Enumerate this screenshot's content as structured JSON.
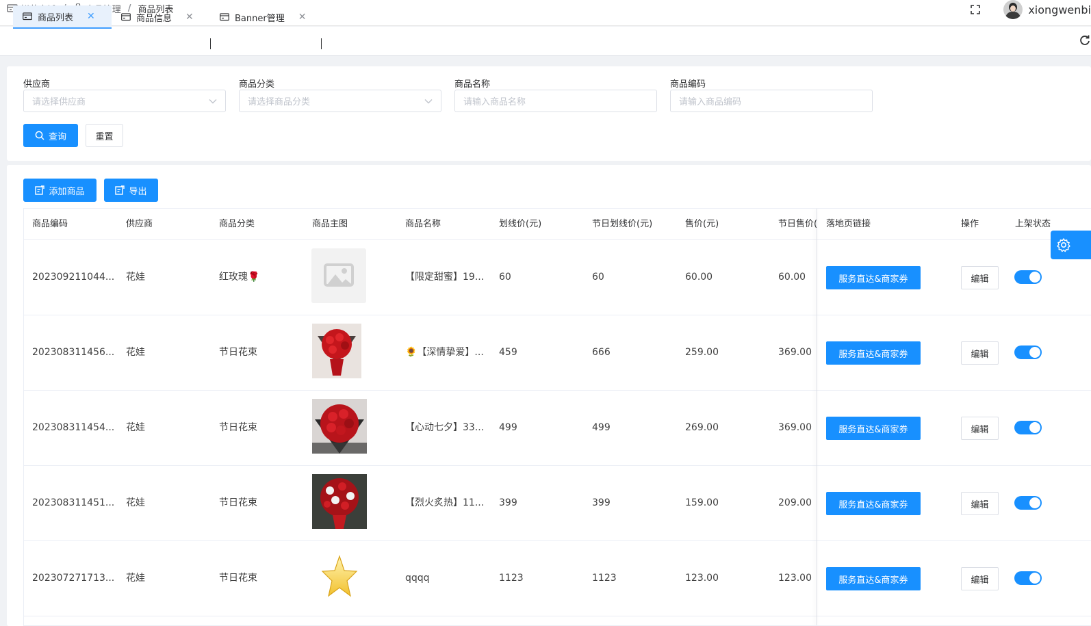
{
  "breadcrumb": [
    "鲜花商城",
    "商品管理",
    "商品列表"
  ],
  "user": {
    "name": "xiongwenbi"
  },
  "tabs": [
    {
      "label": "商品列表",
      "active": true
    },
    {
      "label": "商品信息",
      "active": false
    },
    {
      "label": "Banner管理",
      "active": false
    }
  ],
  "search": {
    "fields": [
      {
        "label": "供应商",
        "placeholder": "请选择供应商",
        "type": "select"
      },
      {
        "label": "商品分类",
        "placeholder": "请选择商品分类",
        "type": "select"
      },
      {
        "label": "商品名称",
        "placeholder": "请输入商品名称",
        "type": "input"
      },
      {
        "label": "商品编码",
        "placeholder": "请输入商品编码",
        "type": "input"
      }
    ],
    "query_label": "查询",
    "reset_label": "重置"
  },
  "toolbar": {
    "add_label": "添加商品",
    "export_label": "导出"
  },
  "table": {
    "headers": [
      "商品编码",
      "供应商",
      "商品分类",
      "商品主图",
      "商品名称",
      "划线价(元)",
      "节日划线价(元)",
      "售价(元)",
      "节日售价(元)",
      "落地页链接",
      "操作",
      "上架状态"
    ],
    "link_label": "服务直达&商家券",
    "edit_label": "编辑",
    "rows": [
      {
        "code": "202309211044...",
        "supplier": "花娃",
        "category": "红玫瑰🌹",
        "image": "placeholder-icon",
        "name": "【限定甜蜜】19...",
        "list_price": "60",
        "holiday_list_price": "60",
        "price": "60.00",
        "holiday_price": "60.00",
        "on_shelf": true
      },
      {
        "code": "202308311456...",
        "supplier": "花娃",
        "category": "节日花束",
        "image": "red-bouquet-photo",
        "name": "🌻【深情挚爱】...",
        "list_price": "459",
        "holiday_list_price": "666",
        "price": "259.00",
        "holiday_price": "369.00",
        "on_shelf": true
      },
      {
        "code": "202308311454...",
        "supplier": "花娃",
        "category": "节日花束",
        "image": "red-rose-bouquet-photo",
        "name": "【心动七夕】33...",
        "list_price": "499",
        "holiday_list_price": "499",
        "price": "269.00",
        "holiday_price": "369.00",
        "on_shelf": true
      },
      {
        "code": "202308311451...",
        "supplier": "花娃",
        "category": "节日花束",
        "image": "mixed-bouquet-photo",
        "name": "【烈火炙热】11...",
        "list_price": "399",
        "holiday_list_price": "399",
        "price": "159.00",
        "holiday_price": "209.00",
        "on_shelf": true
      },
      {
        "code": "202307271713...",
        "supplier": "花娃",
        "category": "节日花束",
        "image": "star-icon",
        "name": "qqqq",
        "list_price": "1123",
        "holiday_list_price": "1123",
        "price": "123.00",
        "holiday_price": "123.00",
        "on_shelf": true
      }
    ]
  },
  "colors": {
    "primary": "#1890ff",
    "border": "#dcdfe6",
    "background": "#f0f2f5"
  }
}
